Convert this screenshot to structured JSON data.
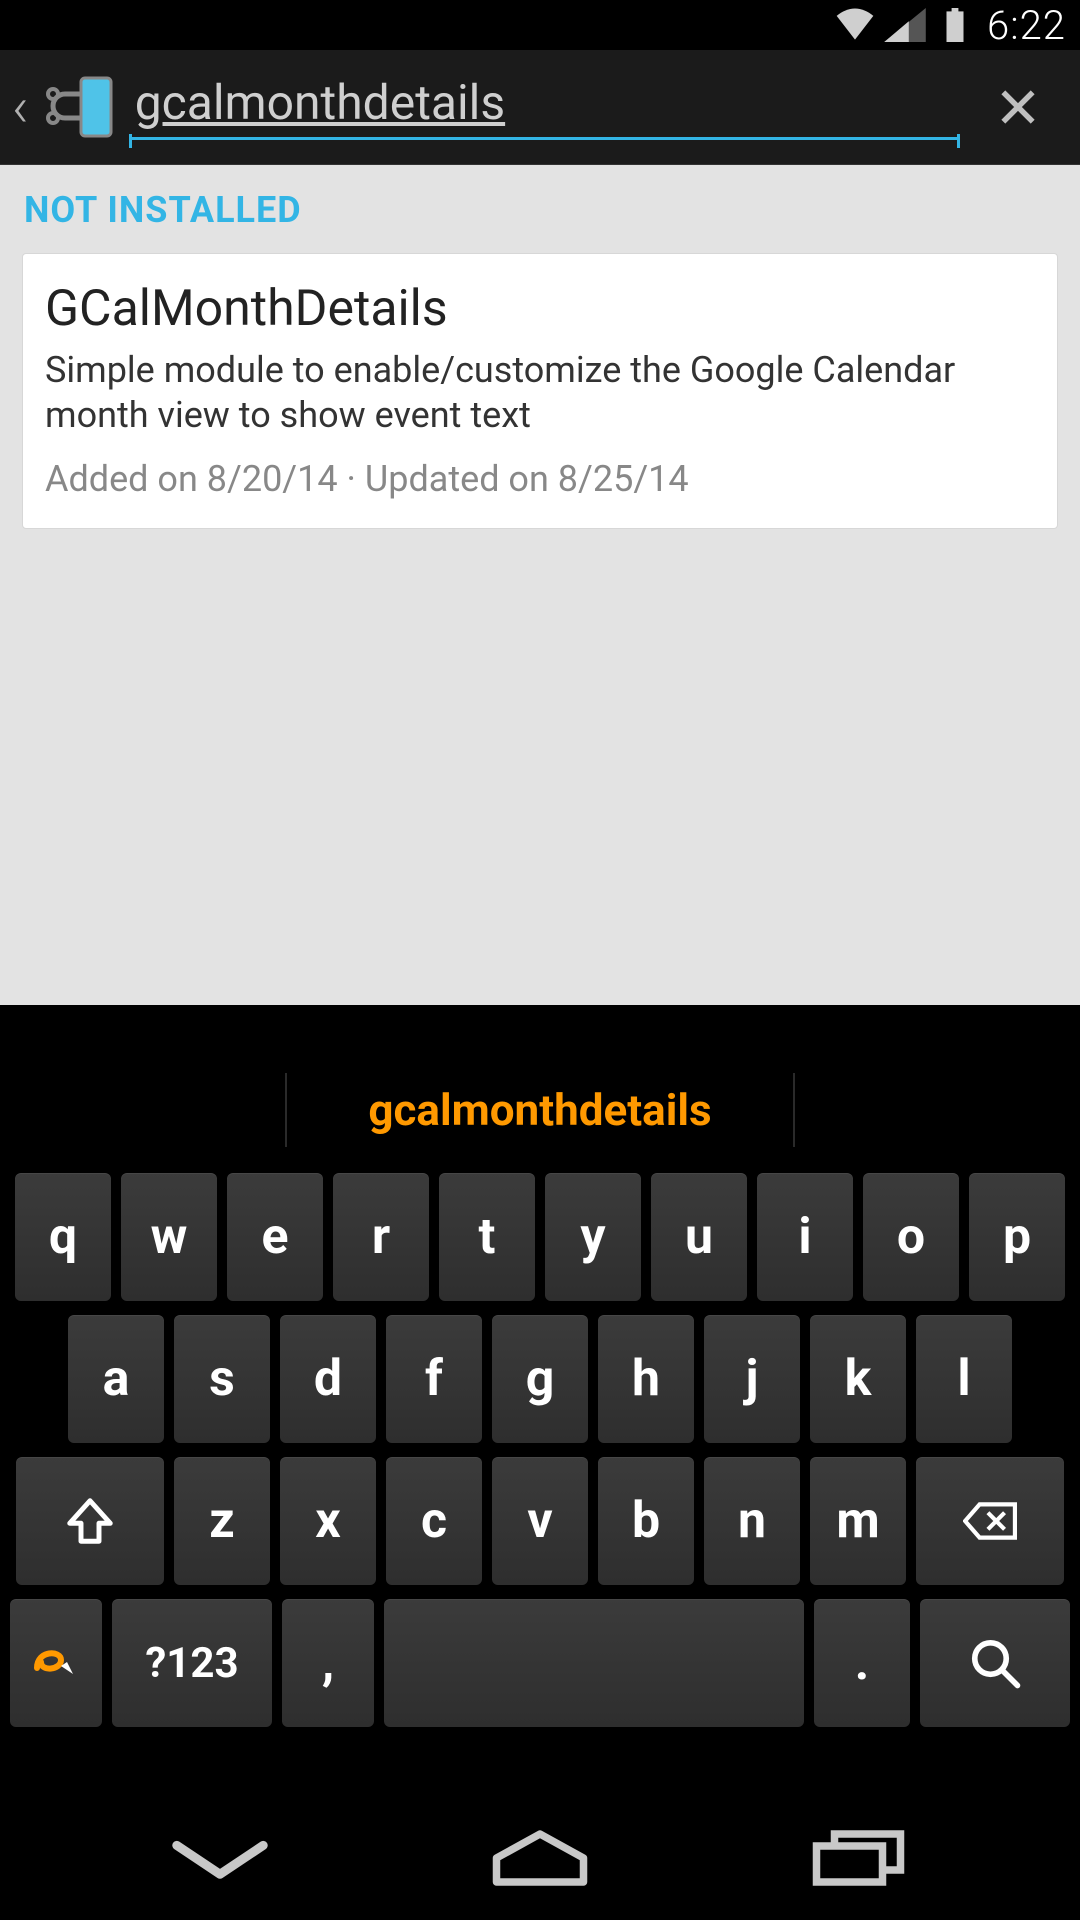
{
  "status": {
    "time": "6:22"
  },
  "header": {
    "search_value": "gcalmonthdetails"
  },
  "content": {
    "section_label": "NOT INSTALLED",
    "card": {
      "title": "GCalMonthDetails",
      "description": "Simple module to enable/customize the Google Calendar month view to show event text",
      "meta": "Added on 8/20/14 · Updated on 8/25/14"
    }
  },
  "keyboard": {
    "suggestion": "gcalmonthdetails",
    "row1": [
      "q",
      "w",
      "e",
      "r",
      "t",
      "y",
      "u",
      "i",
      "o",
      "p"
    ],
    "row2": [
      "a",
      "s",
      "d",
      "f",
      "g",
      "h",
      "j",
      "k",
      "l"
    ],
    "row3": [
      "z",
      "x",
      "c",
      "v",
      "b",
      "n",
      "m"
    ],
    "symbols_label": "?123",
    "comma": ",",
    "period": "."
  }
}
